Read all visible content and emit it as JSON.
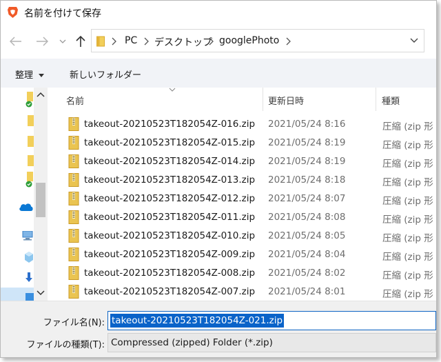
{
  "window": {
    "title": "名前を付けて保存"
  },
  "address": {
    "crumbs": [
      "PC",
      "デスクトップ",
      "googlePhoto"
    ]
  },
  "toolbar": {
    "organize_label": "整理",
    "new_folder_label": "新しいフォルダー"
  },
  "columns": {
    "name": "名前",
    "date": "更新日時",
    "type": "種類"
  },
  "files": [
    {
      "name": "takeout-20210523T182054Z-016.zip",
      "date": "2021/05/24 8:16",
      "type": "圧縮 (zip 形"
    },
    {
      "name": "takeout-20210523T182054Z-015.zip",
      "date": "2021/05/24 8:19",
      "type": "圧縮 (zip 形"
    },
    {
      "name": "takeout-20210523T182054Z-014.zip",
      "date": "2021/05/24 8:19",
      "type": "圧縮 (zip 形"
    },
    {
      "name": "takeout-20210523T182054Z-013.zip",
      "date": "2021/05/24 8:18",
      "type": "圧縮 (zip 形"
    },
    {
      "name": "takeout-20210523T182054Z-012.zip",
      "date": "2021/05/24 8:07",
      "type": "圧縮 (zip 形"
    },
    {
      "name": "takeout-20210523T182054Z-011.zip",
      "date": "2021/05/24 8:08",
      "type": "圧縮 (zip 形"
    },
    {
      "name": "takeout-20210523T182054Z-010.zip",
      "date": "2021/05/24 8:05",
      "type": "圧縮 (zip 形"
    },
    {
      "name": "takeout-20210523T182054Z-009.zip",
      "date": "2021/05/24 8:04",
      "type": "圧縮 (zip 形"
    },
    {
      "name": "takeout-20210523T182054Z-008.zip",
      "date": "2021/05/24 8:02",
      "type": "圧縮 (zip 形"
    },
    {
      "name": "takeout-20210523T182054Z-007.zip",
      "date": "2021/05/24 8:01",
      "type": "圧縮 (zip 形"
    }
  ],
  "form": {
    "filename_label": "ファイル名(N):",
    "filename_value": "takeout-20210523T182054Z-021.zip",
    "filetype_label": "ファイルの種類(T):",
    "filetype_value": "Compressed (zipped) Folder (*.zip)"
  },
  "colors": {
    "accent": "#0a63c9",
    "zip_folder": "#e8c04a",
    "brave_orange": "#f05a28",
    "onedrive_blue": "#0a78d4"
  }
}
